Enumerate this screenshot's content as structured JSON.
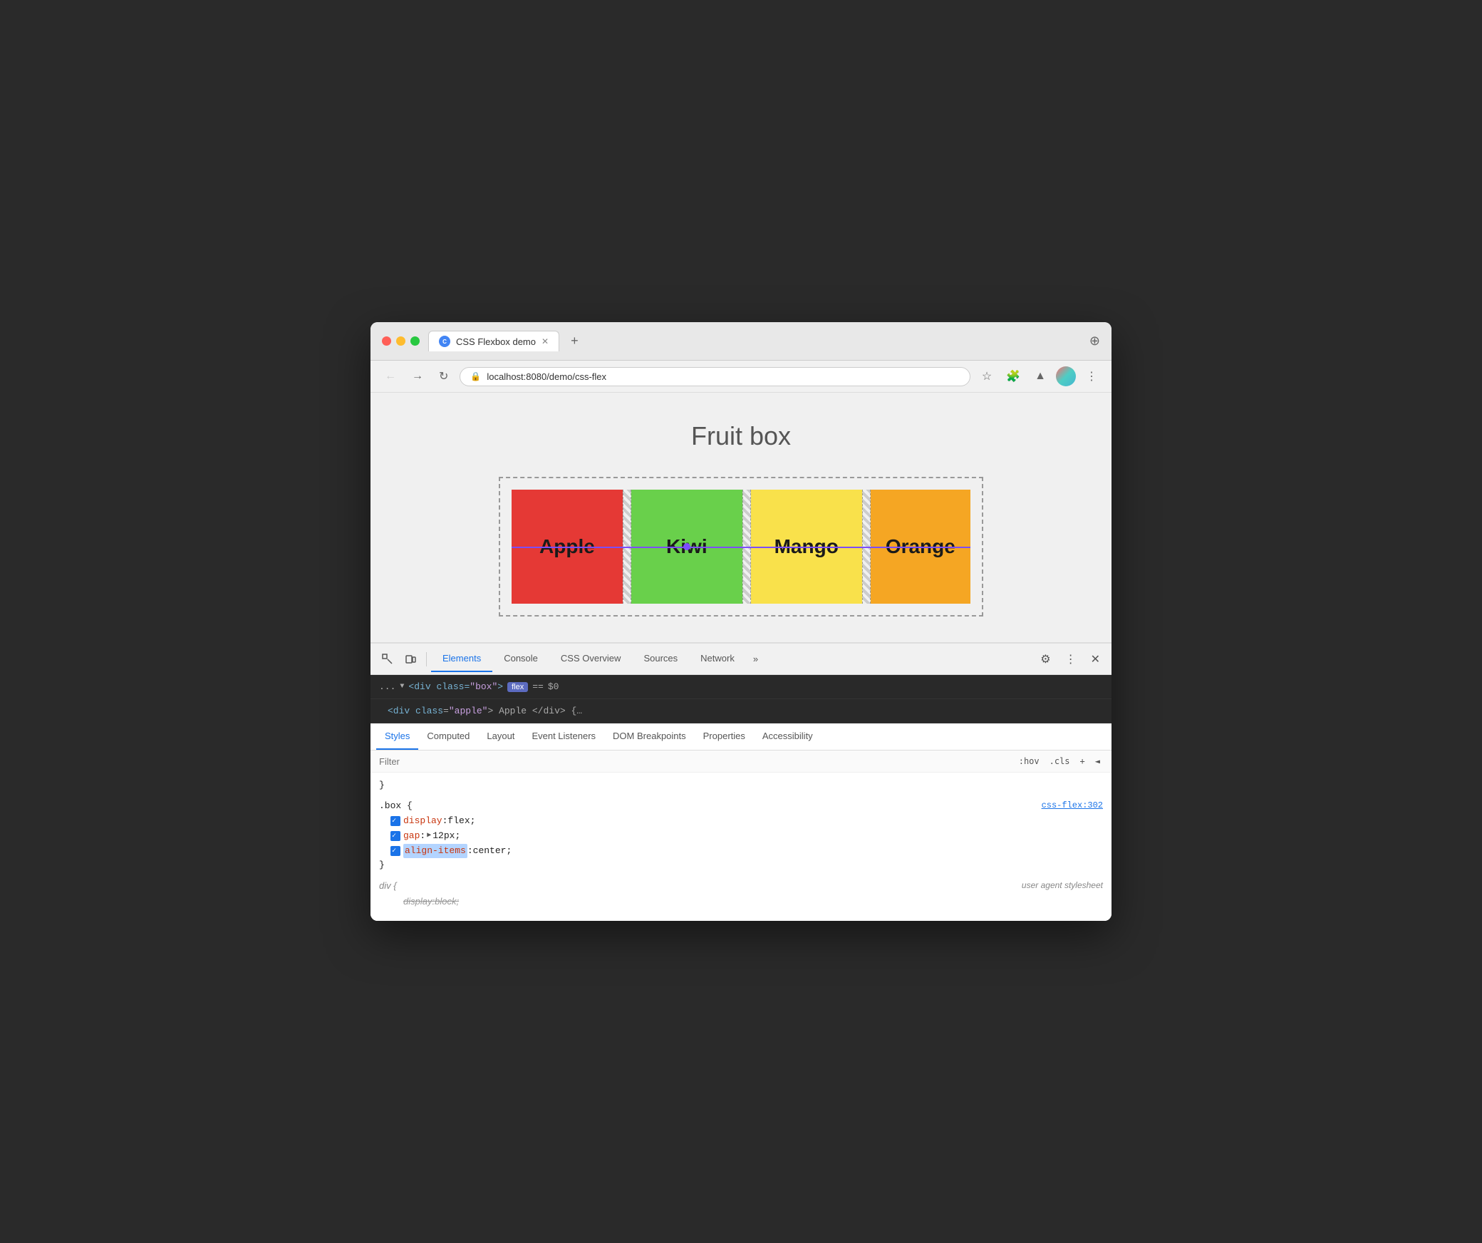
{
  "window": {
    "title": "CSS Flexbox demo",
    "tab_label": "CSS Flexbox demo",
    "url": "localhost:8080/demo/css-flex"
  },
  "page": {
    "heading": "Fruit box",
    "fruits": [
      {
        "label": "Apple",
        "color": "#e53935"
      },
      {
        "label": "Kiwi",
        "color": "#69d04b"
      },
      {
        "label": "Mango",
        "color": "#f9e14b"
      },
      {
        "label": "Orange",
        "color": "#f5a623"
      }
    ]
  },
  "devtools": {
    "tabs": [
      "Elements",
      "Console",
      "CSS Overview",
      "Sources",
      "Network"
    ],
    "active_tab": "Elements",
    "more_label": "»"
  },
  "dom": {
    "ellipsis": "...",
    "tag": "div",
    "attr_name": "class",
    "attr_value": "box",
    "badge": "flex",
    "eq": "==",
    "var": "$0",
    "child_preview": "div class=\"apple\"> Apple </div> {…"
  },
  "subpanel": {
    "tabs": [
      "Styles",
      "Computed",
      "Layout",
      "Event Listeners",
      "DOM Breakpoints",
      "Properties",
      "Accessibility"
    ],
    "active_tab": "Styles"
  },
  "styles": {
    "filter_placeholder": "Filter",
    "hov_label": ":hov",
    "cls_label": ".cls",
    "add_label": "+",
    "toggle_label": "◄",
    "rule1": {
      "selector": ".box {",
      "source": "css-flex:302",
      "properties": [
        {
          "prop": "display",
          "value": "flex",
          "enabled": true
        },
        {
          "prop": "gap",
          "value": "▶ 12px",
          "enabled": true,
          "has_triangle": true
        },
        {
          "prop": "align-items",
          "value": "center",
          "enabled": true,
          "highlighted": true
        }
      ],
      "close": "}"
    },
    "rule2": {
      "selector": "div {",
      "source": "user agent stylesheet",
      "properties": [
        {
          "prop": "display",
          "value": "block",
          "enabled": true,
          "strikethrough": true
        }
      ],
      "close": "}"
    }
  }
}
